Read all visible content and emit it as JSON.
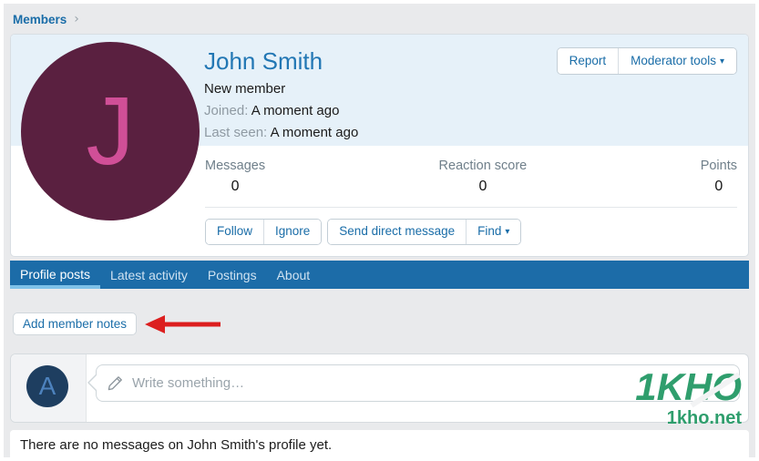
{
  "colors": {
    "accent_blue": "#1a6da8",
    "tab_bar_blue": "#1c6ca8",
    "active_tab_underline": "#7fc1e8",
    "profile_header_bg": "#e6f1f9",
    "page_bg": "#e9eaec",
    "avatar_bg": "#5a2040",
    "avatar_letter_color": "#d04f97",
    "composer_avatar_bg": "#1e3e60",
    "composer_avatar_letter_color": "#4d82bd",
    "arrow_red": "#dc1f1f",
    "watermark_green": "#2f9e6d"
  },
  "icons": {
    "chevron_right": "›",
    "caret_down": "▾"
  },
  "breadcrumb": {
    "members": "Members"
  },
  "profile": {
    "name": "John Smith",
    "avatar_letter": "J",
    "role": "New member",
    "joined_label": "Joined:",
    "joined_value": "A moment ago",
    "last_seen_label": "Last seen:",
    "last_seen_value": "A moment ago",
    "report_button": "Report",
    "moderator_tools_button": "Moderator tools",
    "stats": [
      {
        "label": "Messages",
        "value": "0"
      },
      {
        "label": "Reaction score",
        "value": "0"
      },
      {
        "label": "Points",
        "value": "0"
      }
    ],
    "follow_button": "Follow",
    "ignore_button": "Ignore",
    "send_dm_button": "Send direct message",
    "find_button": "Find"
  },
  "tabs": [
    {
      "label": "Profile posts",
      "active": true
    },
    {
      "label": "Latest activity",
      "active": false
    },
    {
      "label": "Postings",
      "active": false
    },
    {
      "label": "About",
      "active": false
    }
  ],
  "notes": {
    "add_member_notes_button": "Add member notes"
  },
  "composer": {
    "avatar_letter": "A",
    "placeholder": "Write something…"
  },
  "empty_state": {
    "message": "There are no messages on John Smith's profile yet."
  },
  "watermark": {
    "brand": "1KHO",
    "domain": "1kho.net"
  }
}
